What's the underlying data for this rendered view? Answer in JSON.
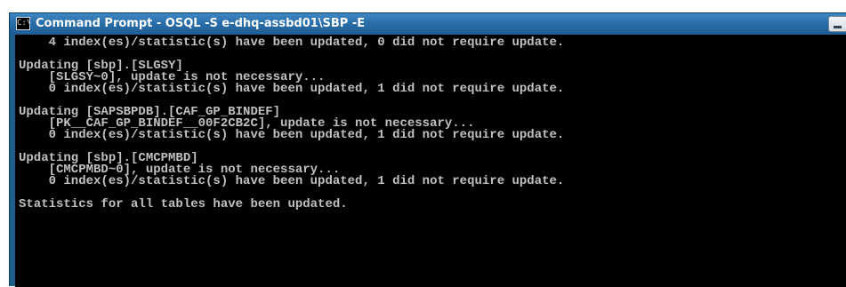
{
  "window": {
    "title": "Command Prompt - OSQL -S e-dhq-assbd01\\SBP -E",
    "icon_glyph": "C:\\",
    "icon_name": "console-app-icon",
    "minimize_icon": "minimize-icon"
  },
  "console": {
    "lines": [
      "    4 index(es)/statistic(s) have been updated, 0 did not require update.",
      "",
      "Updating [sbp].[SLGSY]",
      "    [SLGSY~0], update is not necessary...",
      "    0 index(es)/statistic(s) have been updated, 1 did not require update.",
      "",
      "Updating [SAPSBPDB].[CAF_GP_BINDEF]",
      "    [PK__CAF_GP_BINDEF__00F2CB2C], update is not necessary...",
      "    0 index(es)/statistic(s) have been updated, 1 did not require update.",
      "",
      "Updating [sbp].[CMCPMBD]",
      "    [CMCPMBD~0], update is not necessary...",
      "    0 index(es)/statistic(s) have been updated, 1 did not require update.",
      "",
      "Statistics for all tables have been updated."
    ]
  },
  "colors": {
    "console_bg": "#000000",
    "console_fg": "#c0c0c0",
    "titlebar": "#2a6ea9",
    "title_text": "#ffffff"
  }
}
